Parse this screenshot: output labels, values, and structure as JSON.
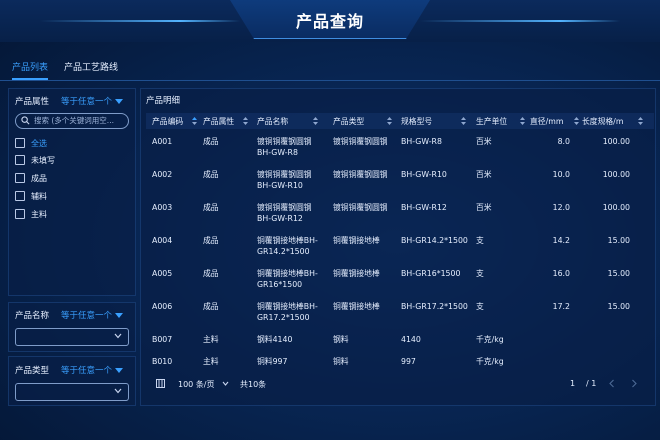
{
  "header": {
    "title": "产品查询"
  },
  "tabs": [
    {
      "label": "产品列表",
      "active": true
    },
    {
      "label": "产品工艺路线",
      "active": false
    }
  ],
  "filters": {
    "attribute": {
      "label": "产品属性",
      "mode": "等于任意一个",
      "search_placeholder": "搜索 (多个关键词用空...",
      "options": [
        "全选",
        "未填写",
        "成品",
        "辅料",
        "主料"
      ],
      "selected": "全选"
    },
    "name": {
      "label": "产品名称",
      "mode": "等于任意一个",
      "value": ""
    },
    "type": {
      "label": "产品类型",
      "mode": "等于任意一个",
      "value": ""
    }
  },
  "table": {
    "title": "产品明细",
    "columns": [
      "产品编码",
      "产品属性",
      "产品名称",
      "产品类型",
      "规格型号",
      "生产单位",
      "直径/mm",
      "长度规格/m"
    ],
    "rows": [
      {
        "code": "A001",
        "attr": "成品",
        "name": [
          "镀铜铜覆钢圆钢",
          "BH-GW-R8"
        ],
        "type": "镀铜铜覆钢圆钢",
        "spec": "BH-GW-R8",
        "unit": "百米",
        "diameter": "8.0",
        "length": "100.00"
      },
      {
        "code": "A002",
        "attr": "成品",
        "name": [
          "镀铜铜覆钢圆钢",
          "BH-GW-R10"
        ],
        "type": "镀铜铜覆钢圆钢",
        "spec": "BH-GW-R10",
        "unit": "百米",
        "diameter": "10.0",
        "length": "100.00"
      },
      {
        "code": "A003",
        "attr": "成品",
        "name": [
          "镀铜铜覆钢圆钢",
          "BH-GW-R12"
        ],
        "type": "镀铜铜覆钢圆钢",
        "spec": "BH-GW-R12",
        "unit": "百米",
        "diameter": "12.0",
        "length": "100.00"
      },
      {
        "code": "A004",
        "attr": "成品",
        "name": [
          "铜覆钢接地棒BH-",
          "GR14.2*1500"
        ],
        "type": "铜覆钢接地棒",
        "spec": "BH-GR14.2*1500",
        "unit": "支",
        "diameter": "14.2",
        "length": "15.00"
      },
      {
        "code": "A005",
        "attr": "成品",
        "name": [
          "铜覆钢接地棒BH-",
          "GR16*1500"
        ],
        "type": "铜覆钢接地棒",
        "spec": "BH-GR16*1500",
        "unit": "支",
        "diameter": "16.0",
        "length": "15.00"
      },
      {
        "code": "A006",
        "attr": "成品",
        "name": [
          "铜覆钢接地棒BH-",
          "GR17.2*1500"
        ],
        "type": "铜覆钢接地棒",
        "spec": "BH-GR17.2*1500",
        "unit": "支",
        "diameter": "17.2",
        "length": "15.00"
      },
      {
        "code": "B007",
        "attr": "主料",
        "name": [
          "钢料4140"
        ],
        "type": "钢料",
        "spec": "4140",
        "unit": "千克/kg",
        "diameter": "",
        "length": ""
      },
      {
        "code": "B010",
        "attr": "主料",
        "name": [
          "铜料997"
        ],
        "type": "铜料",
        "spec": "997",
        "unit": "千克/kg",
        "diameter": "",
        "length": ""
      }
    ]
  },
  "pagination": {
    "page_size": "100 条/页",
    "total": "共10条",
    "current": "1",
    "separator": "/ 1"
  },
  "colors": {
    "accent": "#3aa0ff",
    "background": "#082654",
    "panel": "#0a2458"
  },
  "icons": {
    "search": "search-icon",
    "caret": "caret-down-icon",
    "sort": "sort-icon",
    "chevron": "chevron-down-icon",
    "pager": "page-size-icon",
    "prev": "chevron-left-icon",
    "next": "chevron-right-icon"
  }
}
